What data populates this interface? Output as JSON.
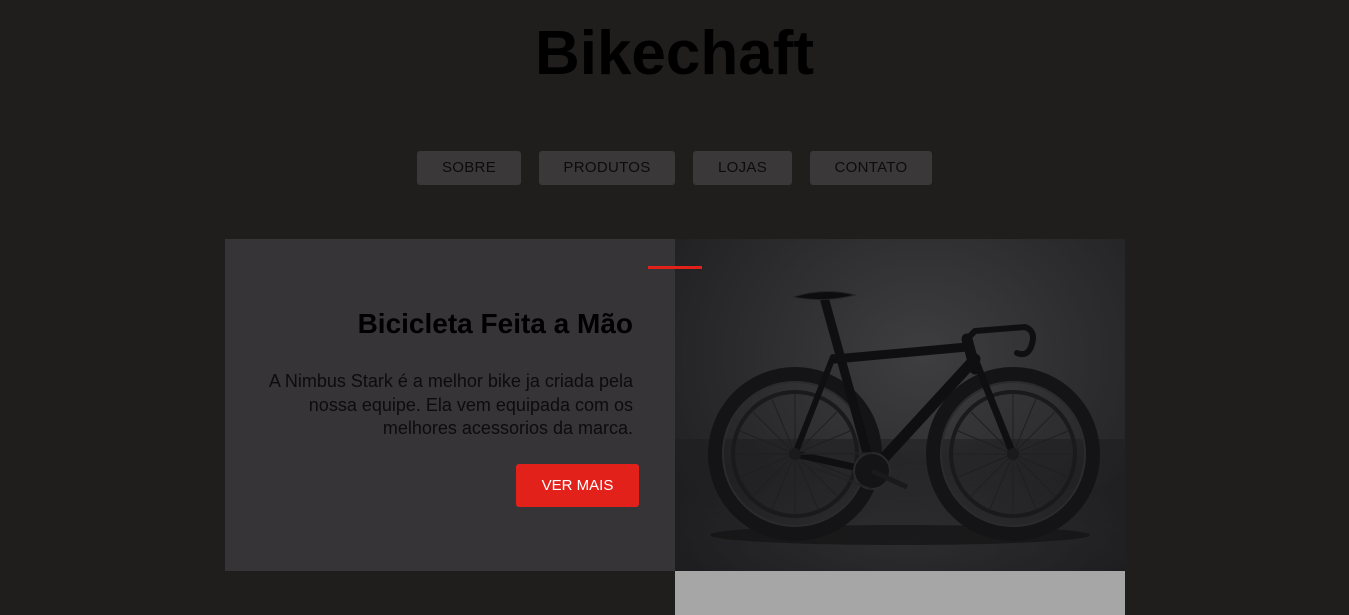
{
  "brand": {
    "title": "Bikechaft"
  },
  "nav": {
    "items": [
      {
        "label": "SOBRE"
      },
      {
        "label": "PRODUTOS"
      },
      {
        "label": "LOJAS"
      },
      {
        "label": "CONTATO"
      }
    ]
  },
  "hero": {
    "title": "Bicicleta Feita a Mão",
    "description": "A Nimbus Stark é a melhor bike ja criada pela nossa equipe. Ela vem equipada com os melhores acessorios da marca.",
    "cta_label": "VER MAIS",
    "image_icon": "bicycle-photo"
  },
  "colors": {
    "background": "#201d1d",
    "accent": "#e3211b",
    "nav_button": "#3a3838",
    "panel": "#363436"
  }
}
